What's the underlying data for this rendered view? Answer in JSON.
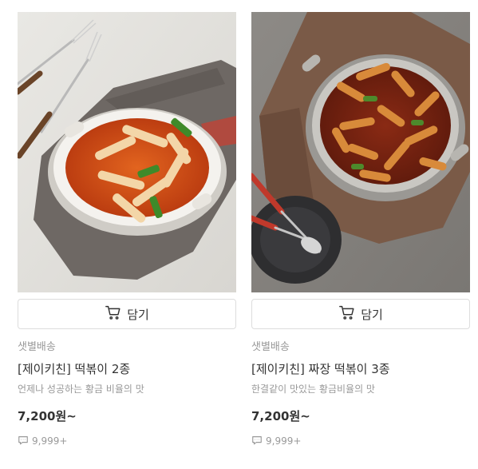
{
  "products": [
    {
      "cart_label": "담기",
      "delivery": "샛별배송",
      "name": "[제이키친] 떡볶이 2종",
      "description": "언제나 성공하는 황금 비율의 맛",
      "price": "7,200원~",
      "review_count": "9,999+",
      "image": "tteokbokki-white-pot"
    },
    {
      "cart_label": "담기",
      "delivery": "샛별배송",
      "name": "[제이키친] 짜장 떡볶이 3종",
      "description": "한결같이 맛있는 황금비율의 맛",
      "price": "7,200원~",
      "review_count": "9,999+",
      "image": "jjajang-tteokbokki-pan"
    }
  ],
  "icons": {
    "cart": "cart-icon",
    "review": "speech-bubble-icon"
  },
  "colors": {
    "border": "#dddddd",
    "muted_text": "#999999",
    "text": "#333333"
  }
}
